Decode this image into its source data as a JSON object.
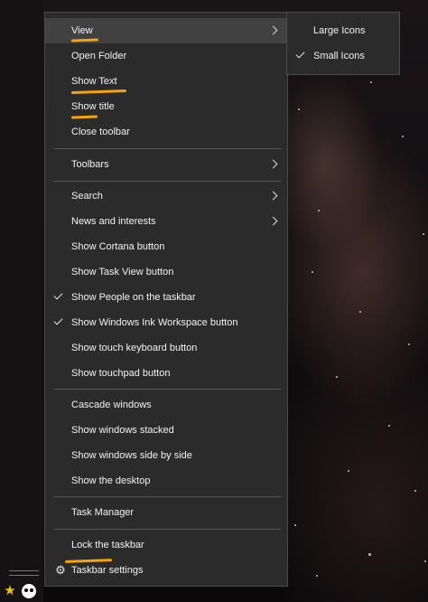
{
  "context_menu": {
    "items": [
      {
        "label": "View",
        "checked": false,
        "has_submenu": true,
        "active": true
      },
      {
        "label": "Open Folder",
        "checked": false,
        "has_submenu": false
      },
      {
        "label": "Show Text",
        "checked": false,
        "has_submenu": false
      },
      {
        "label": "Show title",
        "checked": false,
        "has_submenu": false
      },
      {
        "label": "Close toolbar",
        "checked": false,
        "has_submenu": false
      },
      {
        "label": "Toolbars",
        "checked": false,
        "has_submenu": true
      },
      {
        "label": "Search",
        "checked": false,
        "has_submenu": true
      },
      {
        "label": "News and interests",
        "checked": false,
        "has_submenu": true
      },
      {
        "label": "Show Cortana button",
        "checked": false,
        "has_submenu": false
      },
      {
        "label": "Show Task View button",
        "checked": false,
        "has_submenu": false
      },
      {
        "label": "Show People on the taskbar",
        "checked": true,
        "has_submenu": false
      },
      {
        "label": "Show Windows Ink Workspace button",
        "checked": true,
        "has_submenu": false
      },
      {
        "label": "Show touch keyboard button",
        "checked": false,
        "has_submenu": false
      },
      {
        "label": "Show touchpad button",
        "checked": false,
        "has_submenu": false
      },
      {
        "label": "Cascade windows",
        "checked": false,
        "has_submenu": false
      },
      {
        "label": "Show windows stacked",
        "checked": false,
        "has_submenu": false
      },
      {
        "label": "Show windows side by side",
        "checked": false,
        "has_submenu": false
      },
      {
        "label": "Show the desktop",
        "checked": false,
        "has_submenu": false
      },
      {
        "label": "Task Manager",
        "checked": false,
        "has_submenu": false
      },
      {
        "label": "Lock the taskbar",
        "checked": false,
        "has_submenu": false
      },
      {
        "label": "Taskbar settings",
        "checked": false,
        "has_submenu": false,
        "icon": "gear-icon"
      }
    ]
  },
  "view_submenu": {
    "items": [
      {
        "label": "Large Icons",
        "checked": false
      },
      {
        "label": "Small Icons",
        "checked": true
      }
    ]
  },
  "taskbar_icons": [
    "star-icon",
    "panda-icon"
  ],
  "colors": {
    "menu_bg": "#2b2b2b",
    "highlight": "#414141",
    "annotation": "#f4a40a",
    "text": "#f2f2f2"
  }
}
